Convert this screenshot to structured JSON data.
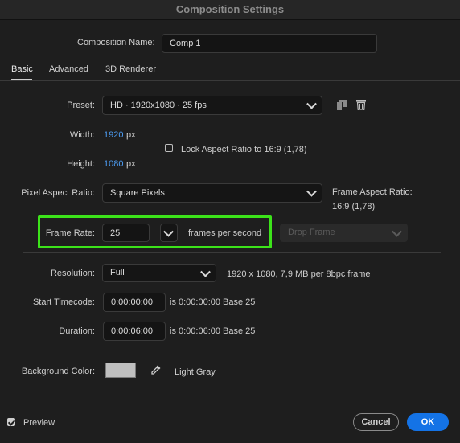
{
  "window": {
    "title": "Composition Settings"
  },
  "composition_name": {
    "label": "Composition Name:",
    "value": "Comp 1"
  },
  "tabs": [
    {
      "label": "Basic",
      "active": true
    },
    {
      "label": "Advanced",
      "active": false
    },
    {
      "label": "3D Renderer",
      "active": false
    }
  ],
  "preset": {
    "label": "Preset:",
    "value": "HD  ·  1920x1080 · 25 fps"
  },
  "width": {
    "label": "Width:",
    "value": "1920",
    "unit": "px"
  },
  "height": {
    "label": "Height:",
    "value": "1080",
    "unit": "px"
  },
  "lock_aspect": {
    "label": "Lock Aspect Ratio to 16:9 (1,78)",
    "checked": false
  },
  "pixel_aspect": {
    "label": "Pixel Aspect Ratio:",
    "value": "Square Pixels"
  },
  "frame_aspect": {
    "label": "Frame Aspect Ratio:",
    "value": "16:9 (1,78)"
  },
  "frame_rate": {
    "label": "Frame Rate:",
    "value": "25",
    "unit": "frames per second",
    "drop_frame": "Drop Frame"
  },
  "resolution": {
    "label": "Resolution:",
    "value": "Full",
    "info": "1920 x 1080, 7,9 MB per 8bpc frame"
  },
  "start_timecode": {
    "label": "Start Timecode:",
    "value": "0:00:00:00",
    "info": "is 0:00:00:00  Base 25"
  },
  "duration": {
    "label": "Duration:",
    "value": "0:00:06:00",
    "info": "is 0:00:06:00  Base 25"
  },
  "background_color": {
    "label": "Background Color:",
    "name": "Light Gray",
    "hex": "#bfbfbf"
  },
  "preview": {
    "label": "Preview",
    "checked": true
  },
  "buttons": {
    "cancel": "Cancel",
    "ok": "OK"
  },
  "colors": {
    "accent": "#1473e6",
    "highlight": "#3ce31a",
    "link_value": "#4c9cf2"
  },
  "icons": {
    "save_preset": "save-icon",
    "delete_preset": "trash-icon",
    "eyedropper": "eyedropper-icon"
  }
}
